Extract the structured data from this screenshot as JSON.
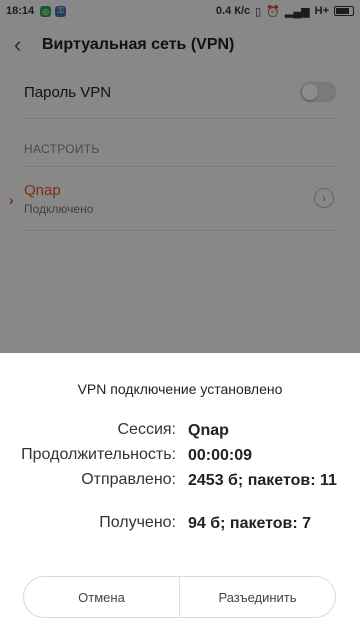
{
  "status_bar": {
    "time": "18:14",
    "rate": "0.4 К/с",
    "network": "H+"
  },
  "header": {
    "title": "Виртуальная сеть (VPN)"
  },
  "password_row": {
    "label": "Пароль VPN"
  },
  "section": {
    "label": "НАСТРОИТЬ"
  },
  "vpn": {
    "name": "Qnap",
    "status": "Подключено"
  },
  "dialog": {
    "title": "VPN подключение установлено",
    "session_label": "Сессия:",
    "session_value": "Qnap",
    "duration_label": "Продолжительность:",
    "duration_value": "00:00:09",
    "sent_label": "Отправлено:",
    "sent_value": "2453 б; пакетов: 11",
    "received_label": "Получено:",
    "received_value": "94 б; пакетов: 7",
    "cancel_label": "Отмена",
    "disconnect_label": "Разъединить"
  },
  "colors": {
    "accent": "#e05a1e"
  }
}
